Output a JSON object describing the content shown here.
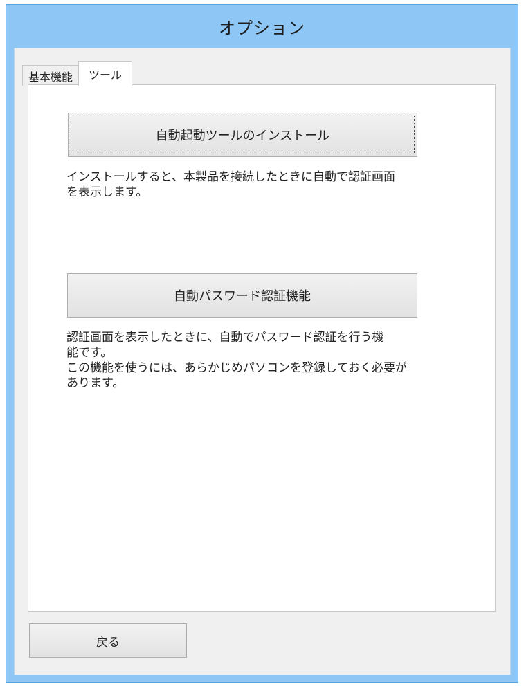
{
  "window": {
    "title": "オプション"
  },
  "tabs": [
    {
      "label": "基本機能",
      "active": false
    },
    {
      "label": "ツール",
      "active": true
    }
  ],
  "tools": {
    "install_button_label": "自動起動ツールのインストール",
    "install_description": "インストールすると、本製品を接続したときに自動で認証画面\nを表示します。",
    "password_button_label": "自動パスワード認証機能",
    "password_description": "認証画面を表示したときに、自動でパスワード認証を行う機\n能です。\nこの機能を使うには、あらかじめパソコンを登録しておく必要が\nあります。"
  },
  "footer": {
    "back_label": "戻る"
  }
}
